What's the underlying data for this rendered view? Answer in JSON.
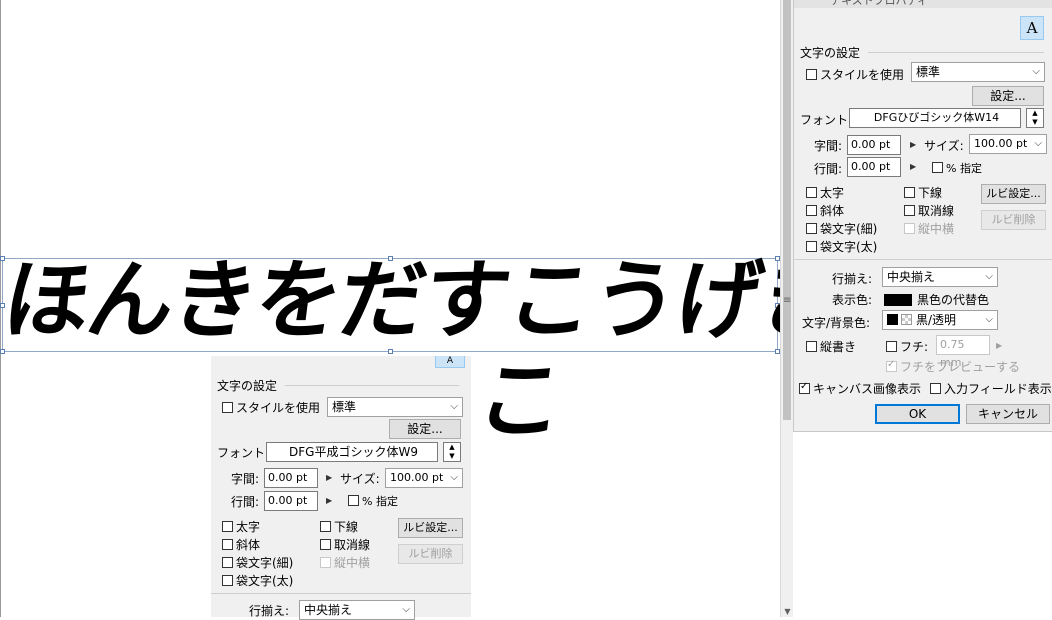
{
  "canvas": {
    "line1": "ほんきをだすこうげき",
    "line2": "こ"
  },
  "panel_right": {
    "title_partial": "テキストプロパティ",
    "section_char": "文字の設定",
    "use_style_label": "スタイルを使用",
    "style_value": "標準",
    "settings_button": "設定...",
    "font_label": "フォント:",
    "font_value": "DFGひびゴシック体W14",
    "tracking_label": "字間:",
    "tracking_value": "0.00 pt",
    "size_label": "サイズ:",
    "size_value": "100.00 pt",
    "leading_label": "行間:",
    "leading_value": "0.00 pt",
    "percent_label": "% 指定",
    "bold_label": "太字",
    "underline_label": "下線",
    "ruby_settings_button": "ルビ設定...",
    "italic_label": "斜体",
    "strike_label": "取消線",
    "ruby_delete_button": "ルビ削除",
    "outline_thin_label": "袋文字(細)",
    "tatechuyoko_label": "縦中横",
    "outline_thick_label": "袋文字(太)",
    "align_label": "行揃え:",
    "align_value": "中央揃え",
    "display_color_label": "表示色:",
    "display_color_value": "黒色の代替色",
    "text_bg_label": "文字/背景色:",
    "text_bg_value": "黒/透明",
    "vertical_label": "縦書き",
    "edge_label": "フチ:",
    "edge_value": "0.75 mm",
    "edge_preview_label": "フチをプレビューする",
    "canvas_image_label": "キャンバス画像表示",
    "input_field_label": "入力フィールド表示",
    "ok_button": "OK",
    "cancel_button": "キャンセル"
  },
  "panel_left": {
    "section_char": "文字の設定",
    "use_style_label": "スタイルを使用",
    "style_value": "標準",
    "settings_button": "設定...",
    "font_label": "フォント:",
    "font_value": "DFG平成ゴシック体W9",
    "tracking_label": "字間:",
    "tracking_value": "0.00 pt",
    "size_label": "サイズ:",
    "size_value": "100.00 pt",
    "leading_label": "行間:",
    "leading_value": "0.00 pt",
    "percent_label": "% 指定",
    "bold_label": "太字",
    "underline_label": "下線",
    "ruby_settings_button": "ルビ設定...",
    "italic_label": "斜体",
    "strike_label": "取消線",
    "ruby_delete_button": "ルビ削除",
    "outline_thin_label": "袋文字(細)",
    "tatechuyoko_label": "縦中横",
    "outline_thick_label": "袋文字(太)",
    "align_label": "行揃え:",
    "align_value": "中央揃え"
  },
  "colors": {
    "accent": "#0078d7",
    "dialog_bg": "#f0f0f0",
    "selected_icon_bg": "#cce4f7"
  },
  "icons": [
    "text-style-icon",
    "chevron-down-icon",
    "play-triangle-icon",
    "spinner-icon"
  ]
}
